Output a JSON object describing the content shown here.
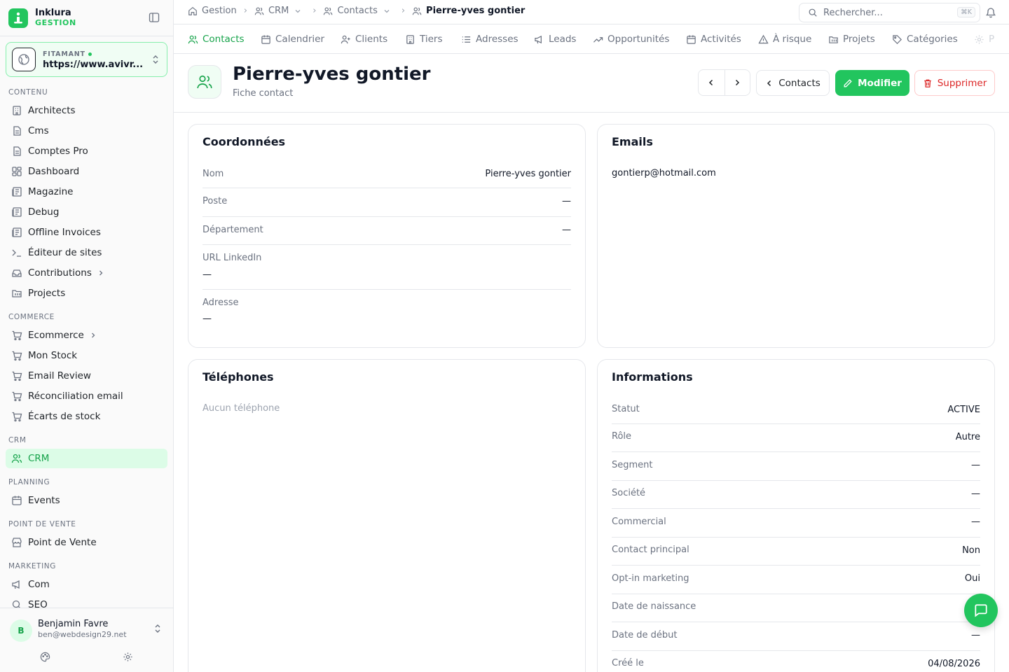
{
  "brand": {
    "name": "Inklura",
    "sub": "GESTION"
  },
  "site": {
    "env": "FITAMANT",
    "url": "https://www.avivr..."
  },
  "nav": {
    "sections": {
      "contenu": "CONTENU",
      "commerce": "COMMERCE",
      "crm": "CRM",
      "planning": "PLANNING",
      "pos": "POINT DE VENTE",
      "marketing": "MARKETING"
    },
    "items": [
      {
        "label": "Architects",
        "icon": "building-icon"
      },
      {
        "label": "Cms",
        "icon": "file-icon"
      },
      {
        "label": "Comptes Pro",
        "icon": "file-icon"
      },
      {
        "label": "Dashboard",
        "icon": "grid-icon"
      },
      {
        "label": "Magazine",
        "icon": "newspaper-icon"
      },
      {
        "label": "Debug",
        "icon": "newspaper-icon"
      },
      {
        "label": "Offline Invoices",
        "icon": "newspaper-icon"
      },
      {
        "label": "Éditeur de sites",
        "icon": "terminal-icon"
      },
      {
        "label": "Contributions",
        "icon": "inbox-icon"
      },
      {
        "label": "Projects",
        "icon": "folder-icon"
      },
      {
        "label": "Ecommerce",
        "icon": "cart-icon"
      },
      {
        "label": "Mon Stock",
        "icon": "cart-icon"
      },
      {
        "label": "Email Review",
        "icon": "cart-icon"
      },
      {
        "label": "Réconciliation email",
        "icon": "cart-icon"
      },
      {
        "label": "Écarts de stock",
        "icon": "cart-icon"
      },
      {
        "label": "CRM",
        "icon": "users-icon"
      },
      {
        "label": "Events",
        "icon": "calendar-icon"
      },
      {
        "label": "Point de Vente",
        "icon": "store-icon"
      },
      {
        "label": "Com",
        "icon": "megaphone-icon"
      },
      {
        "label": "SEO",
        "icon": "search-icon"
      }
    ]
  },
  "user": {
    "initial": "B",
    "name": "Benjamin Favre",
    "email": "ben@webdesign29.net"
  },
  "breadcrumb": {
    "home": "Gestion",
    "crm": "CRM",
    "contacts": "Contacts",
    "current": "Pierre-yves gontier"
  },
  "search": {
    "placeholder": "Rechercher...",
    "shortcut": "⌘K"
  },
  "tabs": [
    {
      "label": "Contacts",
      "icon": "users-icon"
    },
    {
      "label": "Calendrier",
      "icon": "calendar-icon"
    },
    {
      "label": "Clients",
      "icon": "user-plus-icon"
    },
    {
      "label": "Tiers",
      "icon": "building-icon"
    },
    {
      "label": "Adresses",
      "icon": "list-icon"
    },
    {
      "label": "Leads",
      "icon": "megaphone-icon"
    },
    {
      "label": "Opportunités",
      "icon": "trending-up-icon"
    },
    {
      "label": "Activités",
      "icon": "calendar-icon"
    },
    {
      "label": "À risque",
      "icon": "warning-icon"
    },
    {
      "label": "Projets",
      "icon": "folder-icon"
    },
    {
      "label": "Catégories",
      "icon": "tag-icon"
    },
    {
      "label": "P",
      "icon": "gear-icon"
    }
  ],
  "header": {
    "title": "Pierre-yves gontier",
    "subtitle": "Fiche contact"
  },
  "actions": {
    "back": "Contacts",
    "edit": "Modifier",
    "delete": "Supprimer"
  },
  "coordonnees": {
    "title": "Coordonnées",
    "rows": [
      {
        "label": "Nom",
        "value": "Pierre-yves gontier"
      },
      {
        "label": "Poste",
        "value": "—"
      },
      {
        "label": "Département",
        "value": "—"
      },
      {
        "label": "URL LinkedIn",
        "value": "—"
      },
      {
        "label": "Adresse",
        "value": "—"
      }
    ]
  },
  "emails": {
    "title": "Emails",
    "value": "gontierp@hotmail.com"
  },
  "telephones": {
    "title": "Téléphones",
    "empty": "Aucun téléphone"
  },
  "informations": {
    "title": "Informations",
    "rows": [
      {
        "label": "Statut",
        "value": "ACTIVE"
      },
      {
        "label": "Rôle",
        "value": "Autre"
      },
      {
        "label": "Segment",
        "value": "—"
      },
      {
        "label": "Société",
        "value": "—"
      },
      {
        "label": "Commercial",
        "value": "—"
      },
      {
        "label": "Contact principal",
        "value": "Non"
      },
      {
        "label": "Opt-in marketing",
        "value": "Oui"
      },
      {
        "label": "Date de naissance",
        "value": ""
      },
      {
        "label": "Date de début",
        "value": "—"
      },
      {
        "label": "Créé le",
        "value": "04/08/2026"
      }
    ]
  },
  "colors": {
    "accent": "#22c55e",
    "accent_dark": "#16a34a",
    "danger": "#dc2626"
  }
}
